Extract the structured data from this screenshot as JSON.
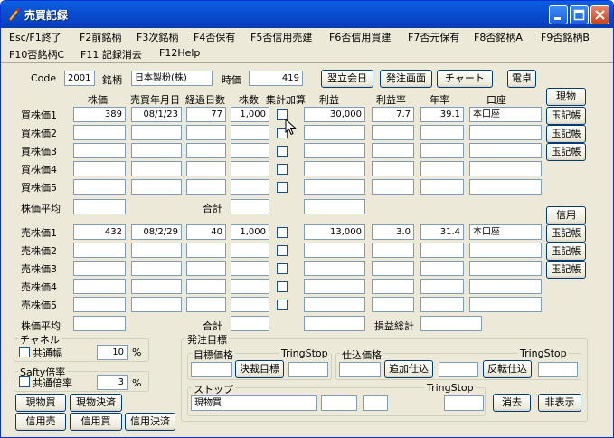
{
  "window": {
    "title": "売買記録"
  },
  "menu": [
    "Esc/F1終了",
    "F2前銘柄",
    "F3次銘柄",
    "F4否保有",
    "F5否信用売建",
    "F6否信用買建",
    "F7否元保有",
    "F8否銘柄A",
    "F9否銘柄B",
    "F10否銘柄C",
    "F11 記録消去",
    "F12Help"
  ],
  "top": {
    "code_label": "Code",
    "code_value": "2001",
    "meigara_label": "銘柄",
    "meigara_value": "日本製粉(株)",
    "jika_label": "時価",
    "jika_value": "419",
    "btn_next_day": "翌立会日",
    "btn_order": "発注画面",
    "btn_chart": "チャート",
    "btn_calc": "電卓"
  },
  "headers": {
    "price": "株価",
    "date": "売買年月日",
    "days": "経過日数",
    "shares": "株数",
    "aggregate": "集計加算",
    "profit": "利益",
    "profit_rate": "利益率",
    "annual": "年率",
    "account": "口座"
  },
  "buy_rows": [
    {
      "label": "買株価1",
      "price": "389",
      "date": "08/1/23",
      "days": "77",
      "shares": "1,000",
      "profit": "30,000",
      "rate": "7.7",
      "annual": "39.1",
      "account": "本口座"
    },
    {
      "label": "買株価2",
      "price": "",
      "date": "",
      "days": "",
      "shares": "",
      "profit": "",
      "rate": "",
      "annual": "",
      "account": ""
    },
    {
      "label": "買株価3",
      "price": "",
      "date": "",
      "days": "",
      "shares": "",
      "profit": "",
      "rate": "",
      "annual": "",
      "account": ""
    },
    {
      "label": "買株価4",
      "price": "",
      "date": "",
      "days": "",
      "shares": "",
      "profit": "",
      "rate": "",
      "annual": "",
      "account": ""
    },
    {
      "label": "買株価5",
      "price": "",
      "date": "",
      "days": "",
      "shares": "",
      "profit": "",
      "rate": "",
      "annual": "",
      "account": ""
    }
  ],
  "sell_rows": [
    {
      "label": "売株価1",
      "price": "432",
      "date": "08/2/29",
      "days": "40",
      "shares": "1,000",
      "profit": "13,000",
      "rate": "3.0",
      "annual": "31.4",
      "account": "本口座"
    },
    {
      "label": "売株価2",
      "price": "",
      "date": "",
      "days": "",
      "shares": "",
      "profit": "",
      "rate": "",
      "annual": "",
      "account": ""
    },
    {
      "label": "売株価3",
      "price": "",
      "date": "",
      "days": "",
      "shares": "",
      "profit": "",
      "rate": "",
      "annual": "",
      "account": ""
    },
    {
      "label": "売株価4",
      "price": "",
      "date": "",
      "days": "",
      "shares": "",
      "profit": "",
      "rate": "",
      "annual": "",
      "account": ""
    },
    {
      "label": "売株価5",
      "price": "",
      "date": "",
      "days": "",
      "shares": "",
      "profit": "",
      "rate": "",
      "annual": "",
      "account": ""
    }
  ],
  "avg_label": "株価平均",
  "total_label": "合計",
  "pl_total_label": "損益総計",
  "side_buttons": {
    "genbutsu": "現物",
    "shinyo": "信用",
    "gyoku": "玉記帳"
  },
  "channel": {
    "title": "チャネル",
    "common_width": "共通幅",
    "value": "10",
    "unit": "%"
  },
  "safety": {
    "title": "Safty倍率",
    "common_mult": "共通倍率",
    "value": "3",
    "unit": "%"
  },
  "bottom_buttons": [
    "現物買",
    "現物決済",
    "信用売",
    "信用買",
    "信用決済"
  ],
  "order": {
    "title": "発注目標",
    "target_price": "目標価格",
    "tring_stop": "TringStop",
    "btn_settle_target": "決裁目標",
    "purchase_price": "仕込価格",
    "btn_add": "追加仕込",
    "btn_reverse": "反転仕込",
    "stop": "ストップ",
    "stop_value": "現物買",
    "btn_clear": "消去",
    "btn_hide": "非表示"
  }
}
